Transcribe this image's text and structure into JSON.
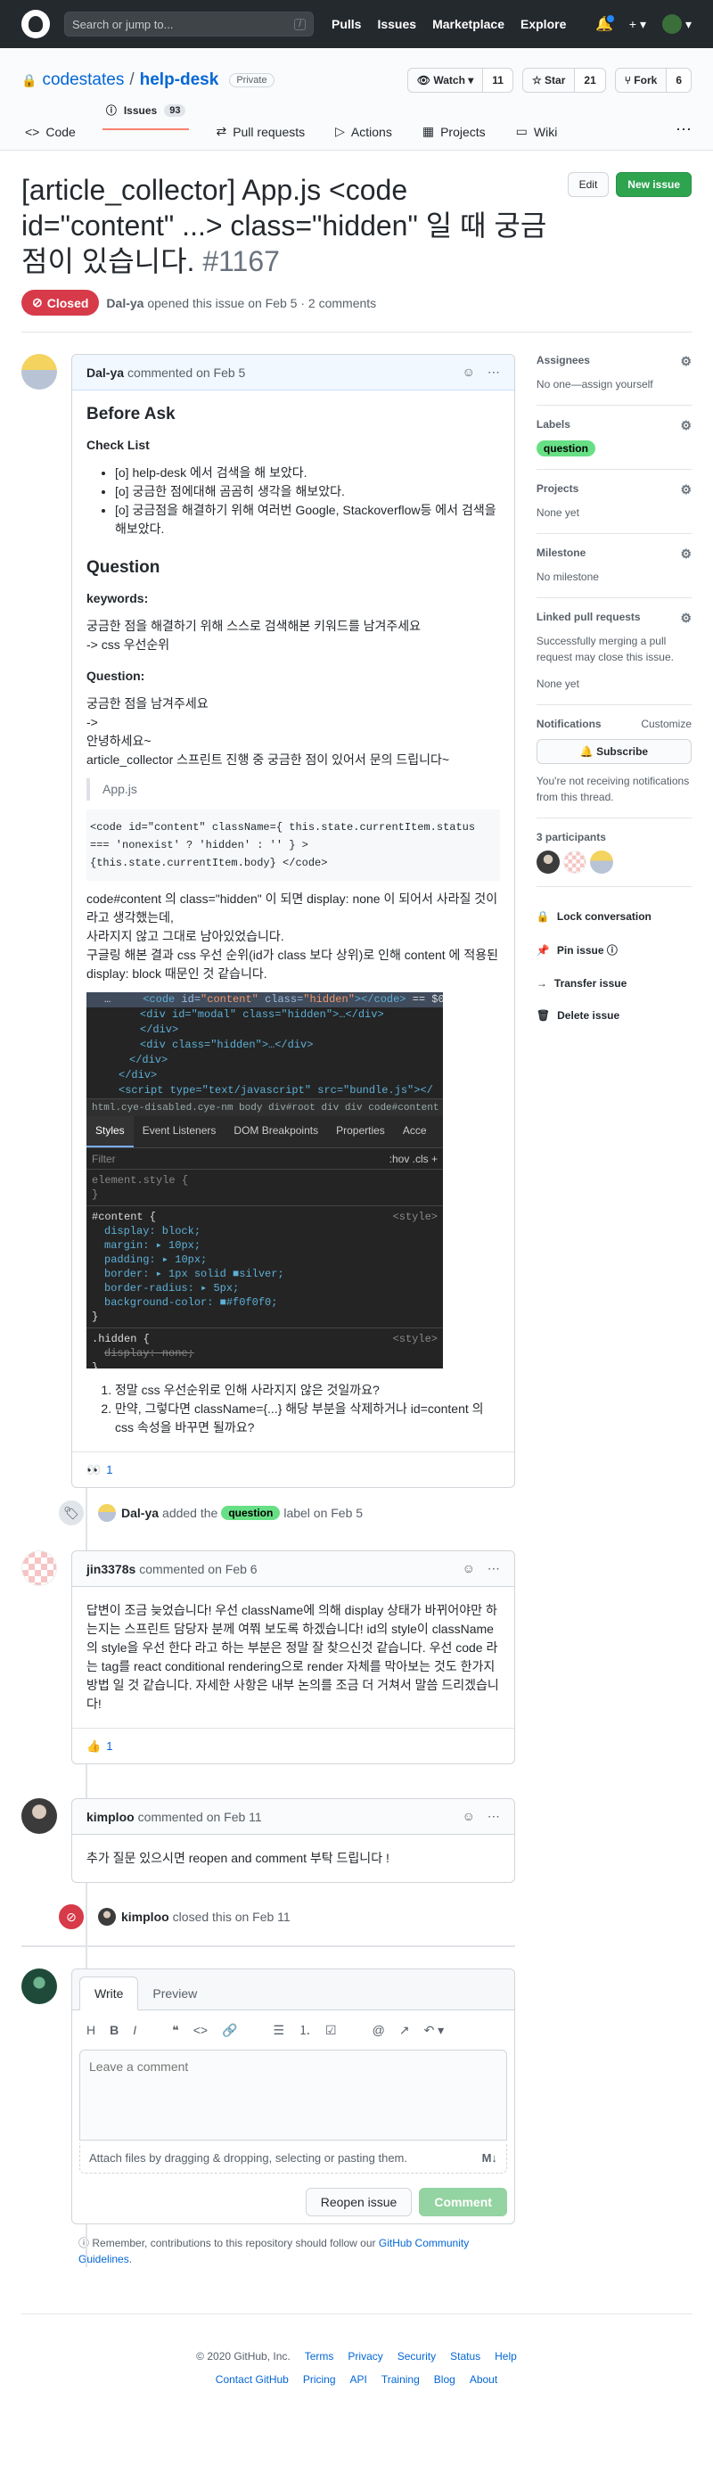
{
  "header": {
    "search_placeholder": "Search or jump to...",
    "slash": "/",
    "nav": [
      "Pulls",
      "Issues",
      "Marketplace",
      "Explore"
    ],
    "plus": "+ ▾",
    "avatar_caret": "▾"
  },
  "repo": {
    "owner": "codestates",
    "sep": "/",
    "name": "help-desk",
    "visibility": "Private",
    "watch_label": "Watch ▾",
    "watch_count": "11",
    "star_label": "Star",
    "star_count": "21",
    "fork_label": "Fork",
    "fork_count": "6",
    "tabs": [
      {
        "label": "Code",
        "icon": "<>"
      },
      {
        "label": "Issues",
        "icon": "ⓘ",
        "count": "93"
      },
      {
        "label": "Pull requests",
        "icon": "⇄"
      },
      {
        "label": "Actions",
        "icon": "▷"
      },
      {
        "label": "Projects",
        "icon": "▦"
      },
      {
        "label": "Wiki",
        "icon": "▭"
      }
    ],
    "more": "⋯"
  },
  "issue": {
    "title": "[article_collector] App.js <code id=\"content\" ...> class=\"hidden\" 일 때 궁금점이 있습니다.",
    "number": "#1167",
    "edit_label": "Edit",
    "new_issue_label": "New issue",
    "state": "Closed",
    "author": "Dal-ya",
    "meta": "opened this issue on Feb 5 · 2 comments"
  },
  "comment1": {
    "author": "Dal-ya",
    "time": "commented on Feb 5",
    "h_before": "Before Ask",
    "h_check": "Check List",
    "checklist": [
      "[o] help-desk 에서 검색을 해 보았다.",
      "[o] 궁금한 점에대해 곰곰히 생각을 해보았다.",
      "[o] 궁금점을 해결하기 위해 여러번 Google, Stackoverflow등 에서 검색을 해보았다."
    ],
    "h_question": "Question",
    "h_keywords": "keywords:",
    "keywords_1": "궁금한 점을 해결하기 위해 스스로 검색해본 키워드를 남겨주세요",
    "keywords_2": "-> css 우선순위",
    "h_q2": "Question:",
    "q_1": "궁금한 점을 남겨주세요",
    "q_2": "->",
    "q_3": "안녕하세요~",
    "q_4": "article_collector 스프린트 진행 중 궁금한 점이 있어서 문의 드립니다~",
    "quote": "App.js",
    "code": "<code id=\"content\" className={ this.state.currentItem.status === 'nonexist' ? 'hidden' : '' } > {this.state.currentItem.body} </code>",
    "p_1": "code#content 의 class=\"hidden\" 이 되면 display: none 이 되어서 사라질 것이라고 생각했는데,",
    "p_2": "사라지지 않고 그대로 남아있었습니다.",
    "p_3": "구글링 해본 결과 css 우선 순위(id가 class 보다 상위)로 인해 content 에 적용된 display: block 때문인 것 같습니다.",
    "devtools": {
      "lines": [
        "<div id=\"modal\" class=\"hidden\">…</div>",
        "</div>",
        "<div class=\"hidden\">…</div>",
        "</div>",
        "</div>",
        "<script type=\"text/javascript\" src=\"bundle.js\"></"
      ],
      "breadcrumb": "html.cye-disabled.cye-nm   body   div#root   div   div   code#content",
      "tabs": [
        "Styles",
        "Event Listeners",
        "DOM Breakpoints",
        "Properties",
        "Acce"
      ],
      "filter": "Filter",
      "filter_right": ":hov  .cls  +",
      "element_style": "element.style {",
      "close_brace": "}",
      "sel_content": "#content {",
      "style_tag": "<style>",
      "props": [
        "display: block;",
        "margin: ▸ 10px;",
        "padding: ▸ 10px;",
        "border: ▸ 1px solid ■silver;",
        "border-radius: ▸ 5px;",
        "background-color: ■#f0f0f0;"
      ],
      "sel_hidden": ".hidden {",
      "hidden_prop": "display: none;"
    },
    "questions": [
      "정말 css 우선순위로 인해 사라지지 않은 것일까요?",
      "만약, 그렇다면 className={...} 해당 부분을 삭제하거나 id=content 의 css 속성을 바꾸면 될까요?"
    ],
    "reaction_emoji": "👀",
    "reaction_count": "1"
  },
  "event_label": {
    "actor": "Dal-ya",
    "before": "added the",
    "label": "question",
    "after": "label on Feb 5"
  },
  "comment2": {
    "author": "jin3378s",
    "time": "commented on Feb 6",
    "body": "답변이 조금 늦었습니다! 우선 className에 의해 display 상태가 바뀌어야만 하는지는 스프린트 담당자 분께 여쭤 보도록 하겠습니다! id의 style이 className의 style을 우선 한다 라고 하는 부분은 정말 잘 찾으신것 같습니다. 우선 code 라는 tag를 react conditional rendering으로 render 자체를 막아보는 것도 한가지 방법 일 것 같습니다. 자세한 사항은 내부 논의를 조금 더 거쳐서 말씀 드리겠습니다!",
    "reaction_emoji": "👍",
    "reaction_count": "1"
  },
  "comment3": {
    "author": "kimploo",
    "time": "commented on Feb 11",
    "body": "추가 질문 있으시면 reopen and comment 부탁 드립니다 !"
  },
  "event_closed": {
    "actor": "kimploo",
    "text": "closed this on Feb 11"
  },
  "newcomment": {
    "tab_write": "Write",
    "tab_preview": "Preview",
    "tools": [
      "H",
      "B",
      "I",
      "❝",
      "<>",
      "🔗",
      "☰",
      "⒈",
      "☑",
      "@",
      "↗",
      "↶ ▾"
    ],
    "placeholder": "Leave a comment",
    "attach": "Attach files by dragging & dropping, selecting or pasting them.",
    "md": "M↓",
    "reopen": "Reopen issue",
    "comment": "Comment",
    "remind_1": "Remember, contributions to this repository should follow our",
    "remind_link": "GitHub Community Guidelines",
    "remind_end": "."
  },
  "sidebar": {
    "assignees_title": "Assignees",
    "assignees_value": "No one—assign yourself",
    "labels_title": "Labels",
    "label": "question",
    "projects_title": "Projects",
    "projects_value": "None yet",
    "milestone_title": "Milestone",
    "milestone_value": "No milestone",
    "linked_title": "Linked pull requests",
    "linked_text": "Successfully merging a pull request may close this issue.",
    "linked_value": "None yet",
    "notif_title": "Notifications",
    "notif_customize": "Customize",
    "subscribe": "🔔 Subscribe",
    "notif_text": "You're not receiving notifications from this thread.",
    "participants": "3 participants",
    "actions": [
      "Lock conversation",
      "Pin issue ⓘ",
      "Transfer issue",
      "Delete issue"
    ],
    "action_icons": [
      "🔒",
      "📌",
      "→",
      "🗑"
    ]
  },
  "footer": {
    "copyright": "© 2020 GitHub, Inc.",
    "row1": [
      "Terms",
      "Privacy",
      "Security",
      "Status",
      "Help"
    ],
    "row2": [
      "Contact GitHub",
      "Pricing",
      "API",
      "Training",
      "Blog",
      "About"
    ]
  }
}
